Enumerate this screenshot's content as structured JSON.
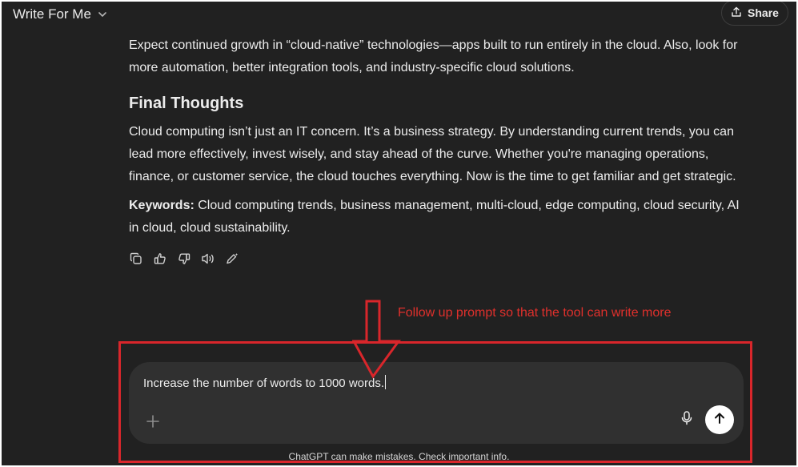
{
  "header": {
    "title": "Write For Me",
    "share_label": "Share"
  },
  "message": {
    "intro_paragraph": "Expect continued growth in “cloud-native” technologies—apps built to run entirely in the cloud. Also, look for more automation, better integration tools, and industry-specific cloud solutions.",
    "heading": "Final Thoughts",
    "body_paragraph": "Cloud computing isn’t just an IT concern. It’s a business strategy. By understanding current trends, you can lead more effectively, invest wisely, and stay ahead of the curve. Whether you're managing operations, finance, or customer service, the cloud touches everything. Now is the time to get familiar and get strategic.",
    "keywords_label": "Keywords:",
    "keywords_text": " Cloud computing trends, business management, multi-cloud, edge computing, cloud security, AI in cloud, cloud sustainability."
  },
  "message_actions": [
    {
      "icon": "copy-icon"
    },
    {
      "icon": "thumbs-up-icon"
    },
    {
      "icon": "thumbs-down-icon"
    },
    {
      "icon": "read-aloud-icon"
    },
    {
      "icon": "edit-icon"
    }
  ],
  "annotation": {
    "text": "Follow up prompt so that the tool can write more",
    "color": "#e0302c"
  },
  "composer": {
    "input_value": "Increase the number of words to 1000 words."
  },
  "footer": {
    "disclaimer": "ChatGPT can make mistakes. Check important info."
  },
  "colors": {
    "background": "#212121",
    "composer": "#303030",
    "text": "#ececec",
    "annotation_red": "#d9262b"
  }
}
